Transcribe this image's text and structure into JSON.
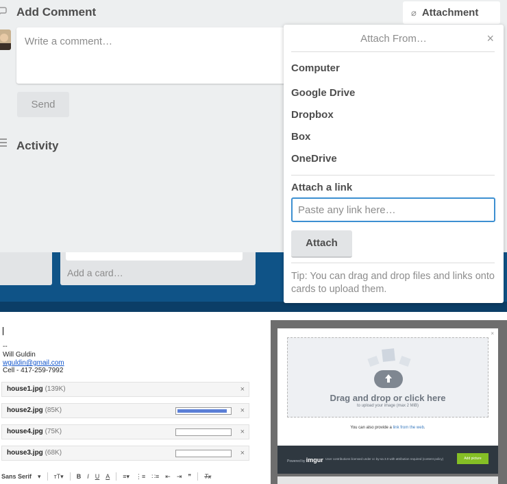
{
  "trello": {
    "add_comment_title": "Add Comment",
    "comment_placeholder": "Write a comment…",
    "send_label": "Send",
    "activity_title": "Activity",
    "attachment_button": "Attachment",
    "add_card": "Add a card…",
    "attach_popover": {
      "title": "Attach From…",
      "close": "×",
      "sources": [
        "Computer",
        "Google Drive",
        "Dropbox",
        "Box",
        "OneDrive"
      ],
      "attach_link_title": "Attach a link",
      "link_placeholder": "Paste any link here…",
      "attach_button": "Attach",
      "tip": "Tip: You can drag and drop files and links onto cards to upload them."
    },
    "colors": {
      "board": "#0f5387",
      "input_focus": "#3c8fd1",
      "modal_bg": "#edeff0"
    }
  },
  "gmail": {
    "signature": {
      "dashes": "--",
      "name": "Will Guldin",
      "email": "wguldin@gmail.com",
      "cell": "Cell - 417-259-7992"
    },
    "attachments": [
      {
        "name": "house1.jpg",
        "size": "(139K)",
        "progress": null
      },
      {
        "name": "house2.jpg",
        "size": "(85K)",
        "progress": 0.95
      },
      {
        "name": "house4.jpg",
        "size": "(75K)",
        "progress": 0
      },
      {
        "name": "house3.jpg",
        "size": "(68K)",
        "progress": 0
      }
    ],
    "remove_label": "×",
    "toolbar": {
      "font": "Sans Serif",
      "size_icon": "text-size-icon",
      "bold": "B",
      "italic": "I",
      "underline": "U",
      "text_color": "A",
      "quote": "❞",
      "clear_format": "Tx"
    }
  },
  "imgur": {
    "drop_title": "Drag and drop or click here",
    "drop_subtitle": "to upload your image (max 2 MiB)",
    "weblink_prefix": "You can also provide a",
    "weblink_link": "link from the web",
    "powered_by": "Powered by",
    "logo": "imgur",
    "license": "User contributions licensed under cc by-sa 3.0 with attribution required (content policy)",
    "add_picture": "Add picture",
    "close": "×",
    "colors": {
      "footer": "#2f3840",
      "add_button": "#85bf25"
    }
  }
}
